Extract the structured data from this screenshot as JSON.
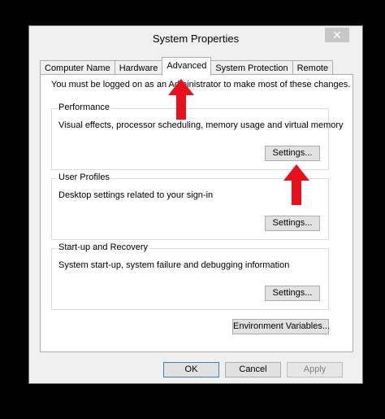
{
  "window": {
    "title": "System Properties",
    "close_glyph": "✕"
  },
  "tabs": [
    {
      "label": "Computer Name"
    },
    {
      "label": "Hardware"
    },
    {
      "label": "Advanced"
    },
    {
      "label": "System Protection"
    },
    {
      "label": "Remote"
    }
  ],
  "advanced": {
    "admin_note": "You must be logged on as an Administrator to make most of these changes.",
    "performance": {
      "title": "Performance",
      "description": "Visual effects, processor scheduling, memory usage and virtual memory",
      "button": "Settings..."
    },
    "user_profiles": {
      "title": "User Profiles",
      "description": "Desktop settings related to your sign-in",
      "button": "Settings..."
    },
    "startup_recovery": {
      "title": "Start-up and Recovery",
      "description": "System start-up, system failure and debugging information",
      "button": "Settings..."
    },
    "environment_button": "Environment Variables..."
  },
  "footer": {
    "ok": "OK",
    "cancel": "Cancel",
    "apply": "Apply"
  },
  "colors": {
    "arrow": "#e8101a",
    "background": "#000000",
    "window": "#f0f0f0"
  }
}
